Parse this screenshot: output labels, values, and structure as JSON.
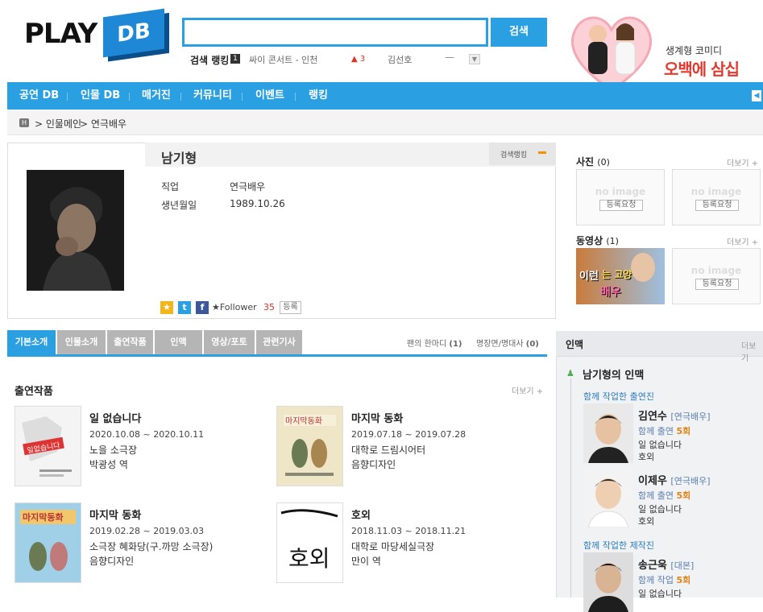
{
  "header": {
    "logo_play": "PLAY",
    "logo_db": "DB",
    "search_btn": "검색",
    "rank_label": "검색 랭킹",
    "rank_num": "1",
    "rank_item": "싸이 콘서트 - 인천",
    "rank_change": "▲ 3",
    "rank_item2": "김선호",
    "rank_dash": "—"
  },
  "banner": {
    "sub": "생계형 코미디",
    "main": "오백에 삼십"
  },
  "nav": [
    "공연 DB",
    "인물 DB",
    "매거진",
    "커뮤니티",
    "이벤트",
    "랭킹"
  ],
  "breadcrumb": {
    "home": "H",
    "level1": "인물메인",
    "level2": "연극배우"
  },
  "profile": {
    "name": "남기형",
    "search_rank": "검색랭킹",
    "job_label": "직업",
    "job": "연극배우",
    "birth_label": "생년월일",
    "birth": "1989.10.26",
    "follower_label": "★Follower",
    "follower_count": "35",
    "register": "등록"
  },
  "side": {
    "photo_title": "사진",
    "photo_count": "(0)",
    "video_title": "동영상",
    "video_count": "(1)",
    "more": "더보기 +",
    "noimg": "no image",
    "req": "등록요청",
    "video_caption_1": "이런",
    "video_caption_2": "는 고양이",
    "video_caption_3": "배우"
  },
  "tabs": [
    "기본소개",
    "인물소개",
    "출연작품",
    "인맥",
    "영상/포토",
    "관련기사"
  ],
  "tabs_right": {
    "fan": "팬의 한마디",
    "fan_count": "(1)",
    "quote": "명장면/명대사",
    "quote_count": "(0)"
  },
  "works": {
    "title": "출연작품",
    "more": "더보기 +",
    "items": [
      {
        "title": "일 없습니다",
        "date": "2020.10.08 ~ 2020.10.11",
        "venue": "노을 소극장",
        "role": "박광성 역",
        "poster_text": "일없습니다"
      },
      {
        "title": "마지막 동화",
        "date": "2019.07.18 ~ 2019.07.28",
        "venue": "대학로 드림시어터",
        "role": "음향디자인",
        "poster_text": "마지막동화"
      },
      {
        "title": "마지막 동화",
        "date": "2019.02.28 ~ 2019.03.03",
        "venue": "소극장 혜화당(구.까망 소극장)",
        "role": "음향디자인",
        "poster_text": "마지막동화"
      },
      {
        "title": "호외",
        "date": "2018.11.03 ~ 2018.11.21",
        "venue": "대학로 마당세실극장",
        "role": "만이 역",
        "poster_text": "호외"
      }
    ]
  },
  "inmaek": {
    "title": "인맥",
    "more": "더보기",
    "heading": "남기형의 인맥",
    "group1": "함께 작업한 출연진",
    "group2": "함께 작업한 제작진",
    "people": [
      {
        "name": "김연수",
        "cat": "[연극배우]",
        "rel": "함께 출연",
        "count": "5회",
        "w1": "일 없습니다",
        "w2": "호외"
      },
      {
        "name": "이제우",
        "cat": "[연극배우]",
        "rel": "함께 출연",
        "count": "5회",
        "w1": "일 없습니다",
        "w2": "호외"
      },
      {
        "name": "송근욱",
        "cat": "[대본]",
        "rel": "함께 작업",
        "count": "5회",
        "w1": "일 없습니다",
        "w2": ""
      }
    ]
  },
  "colors": {
    "accent": "#2aa0e3",
    "banner_red": "#e23a2e",
    "count_orange": "#e0841a"
  }
}
